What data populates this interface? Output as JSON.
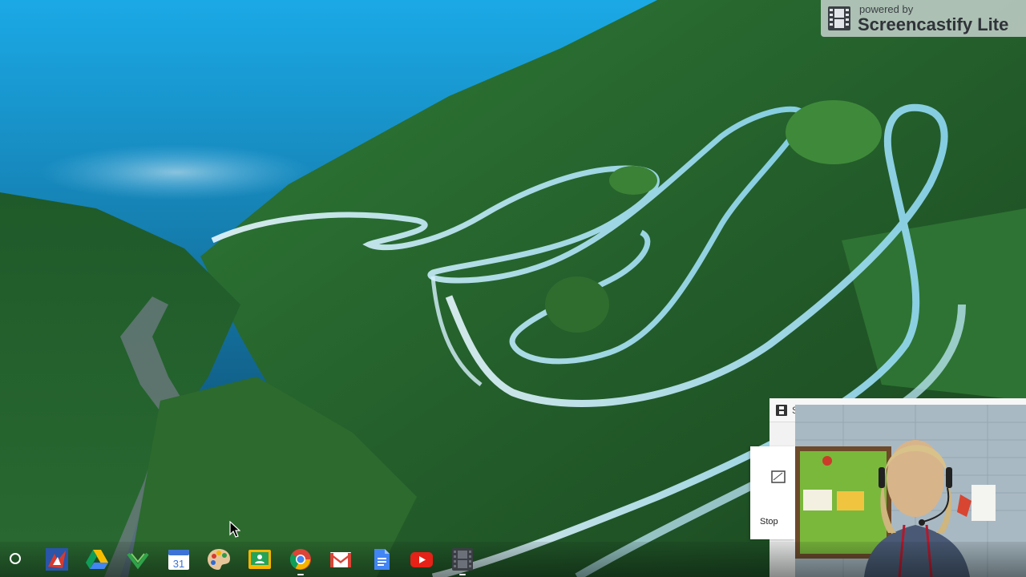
{
  "watermark": {
    "powered_label": "powered by",
    "brand_label": "Screencastify Lite"
  },
  "recording_panel": {
    "header_label": "S",
    "stop_label": "Stop"
  },
  "shelf": {
    "apps": [
      {
        "name": "app-launcher-icon"
      },
      {
        "name": "custom-app-icon"
      },
      {
        "name": "google-drive-icon"
      },
      {
        "name": "drive-companion-icon"
      },
      {
        "name": "google-calendar-icon",
        "label": "31"
      },
      {
        "name": "paint-palette-icon"
      },
      {
        "name": "google-classroom-icon"
      },
      {
        "name": "chrome-icon"
      },
      {
        "name": "gmail-icon"
      },
      {
        "name": "google-docs-icon"
      },
      {
        "name": "youtube-icon"
      },
      {
        "name": "screencastify-icon"
      }
    ]
  },
  "colors": {
    "sky_top": "#1aa6e4",
    "forest": "#2d6b31",
    "road_light": "#cfe9f3",
    "panel_bg": "#f2f2f2"
  }
}
